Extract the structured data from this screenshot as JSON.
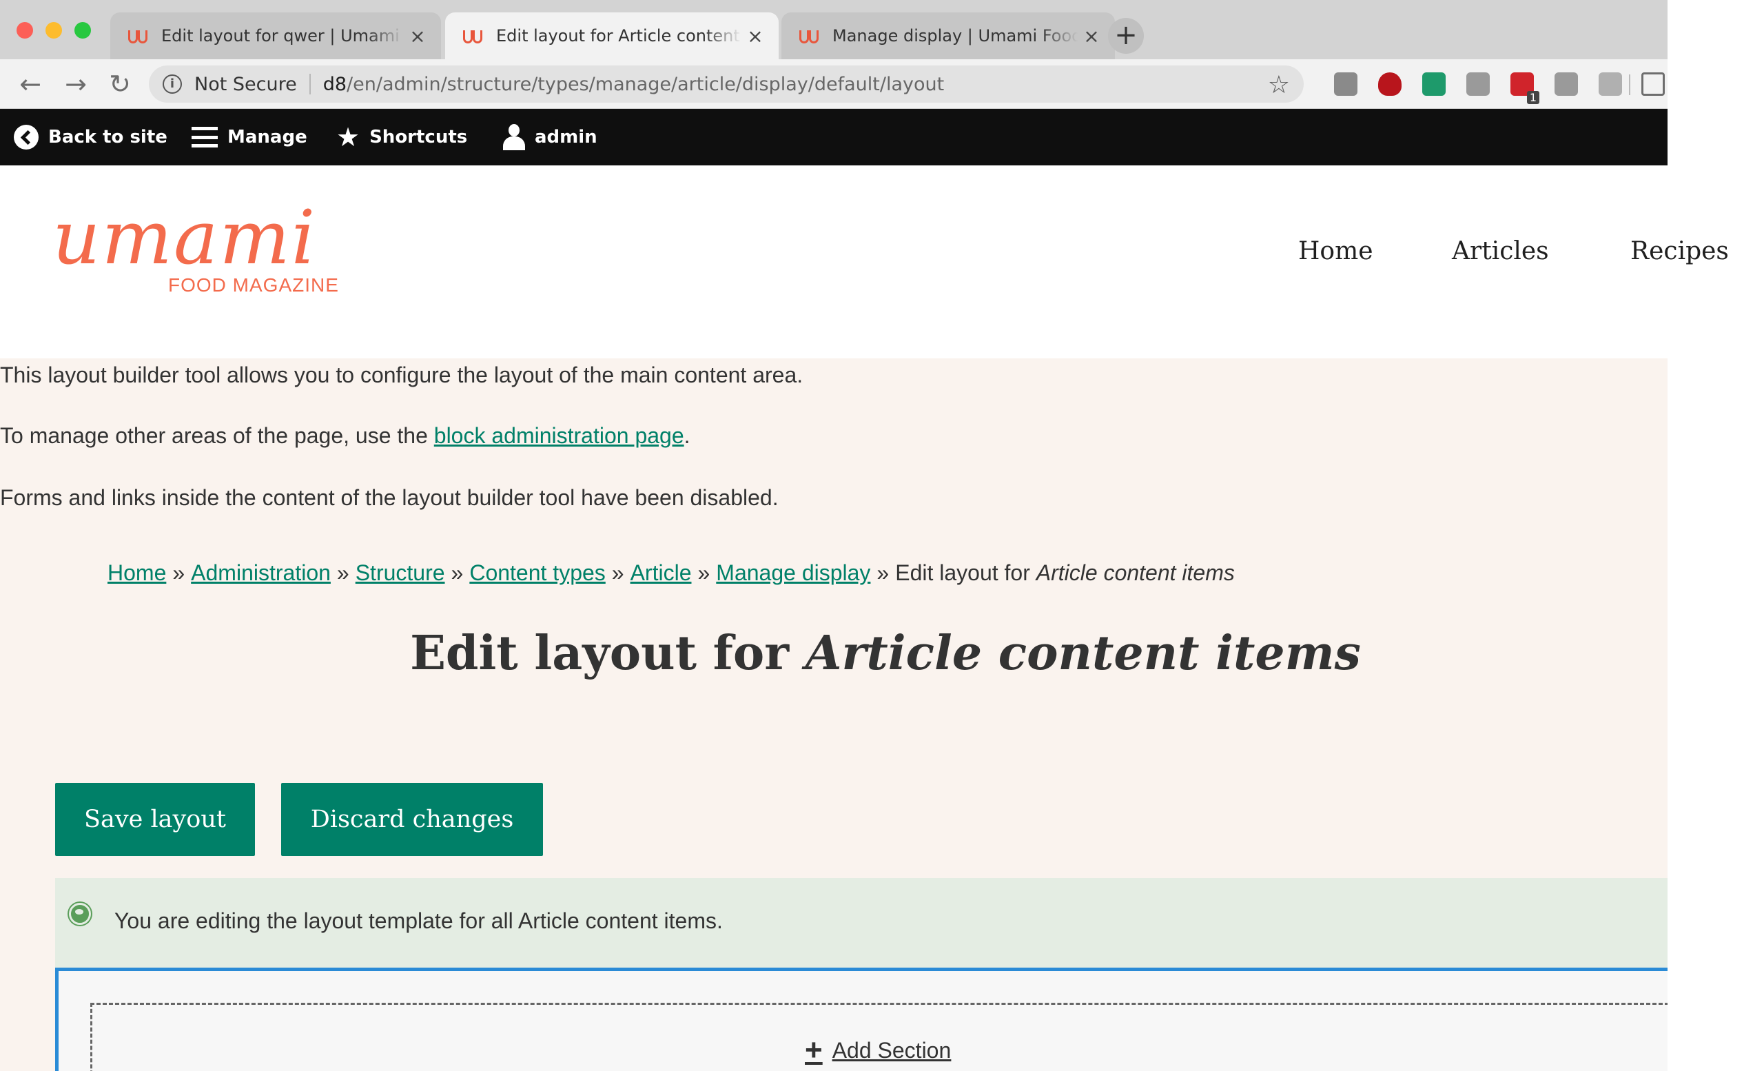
{
  "browser": {
    "tabs": [
      {
        "title": "Edit layout for qwer | Umami Food Magazine",
        "active": false
      },
      {
        "title": "Edit layout for Article content items | Umami Food Magazine",
        "active": true
      },
      {
        "title": "Manage display | Umami Food Magazine",
        "active": false
      }
    ],
    "tab_close_glyph": "×",
    "new_tab_glyph": "+",
    "address": {
      "security_label": "Not Secure",
      "host": "d8",
      "path": "/en/admin/structure/types/manage/article/display/default/layout"
    },
    "nav": {
      "back_glyph": "←",
      "forward_glyph": "→",
      "reload_glyph": "↻",
      "star_glyph": "☆",
      "info_glyph": "i"
    },
    "extension_colors": [
      "#8a8a8a",
      "#b8151c",
      "#1e9a6b",
      "#9a9a9a",
      "#d0242b",
      "#9a9a9a",
      "#b0b0b0",
      "#6e6e6e"
    ],
    "extension_badge": "1"
  },
  "admin_toolbar": {
    "back_label": "Back to site",
    "manage_label": "Manage",
    "shortcuts_label": "Shortcuts",
    "user_label": "admin",
    "star_glyph": "★"
  },
  "site": {
    "logo_word": "umami",
    "logo_tagline": "FOOD MAGAZINE",
    "nav": [
      "Home",
      "Articles",
      "Recipes"
    ]
  },
  "help": {
    "line1": "This layout builder tool allows you to configure the layout of the main content area.",
    "line2_prefix": "To manage other areas of the page, use the ",
    "line2_link": "block administration page",
    "line2_suffix": ".",
    "line3": "Forms and links inside the content of the layout builder tool have been disabled."
  },
  "breadcrumb": {
    "links": [
      "Home",
      "Administration",
      "Structure",
      "Content types",
      "Article",
      "Manage display"
    ],
    "separator": "»",
    "current_prefix": "Edit layout for ",
    "current_emphasis": "Article content items"
  },
  "page_title": {
    "prefix": "Edit layout for ",
    "emphasis": "Article content items"
  },
  "actions": {
    "save_label": "Save layout",
    "discard_label": "Discard changes"
  },
  "message": {
    "text": "You are editing the layout template for all Article content items."
  },
  "layout_builder": {
    "add_section_label": "Add Section",
    "add_glyph": "+"
  },
  "colors": {
    "brand_coral": "#f36b4c",
    "drupal_green": "#008068",
    "content_bg": "#faf3ee",
    "message_bg": "#e4ede3",
    "layout_outline": "#2a8bd6",
    "admin_bar_bg": "#0f0f0f"
  }
}
